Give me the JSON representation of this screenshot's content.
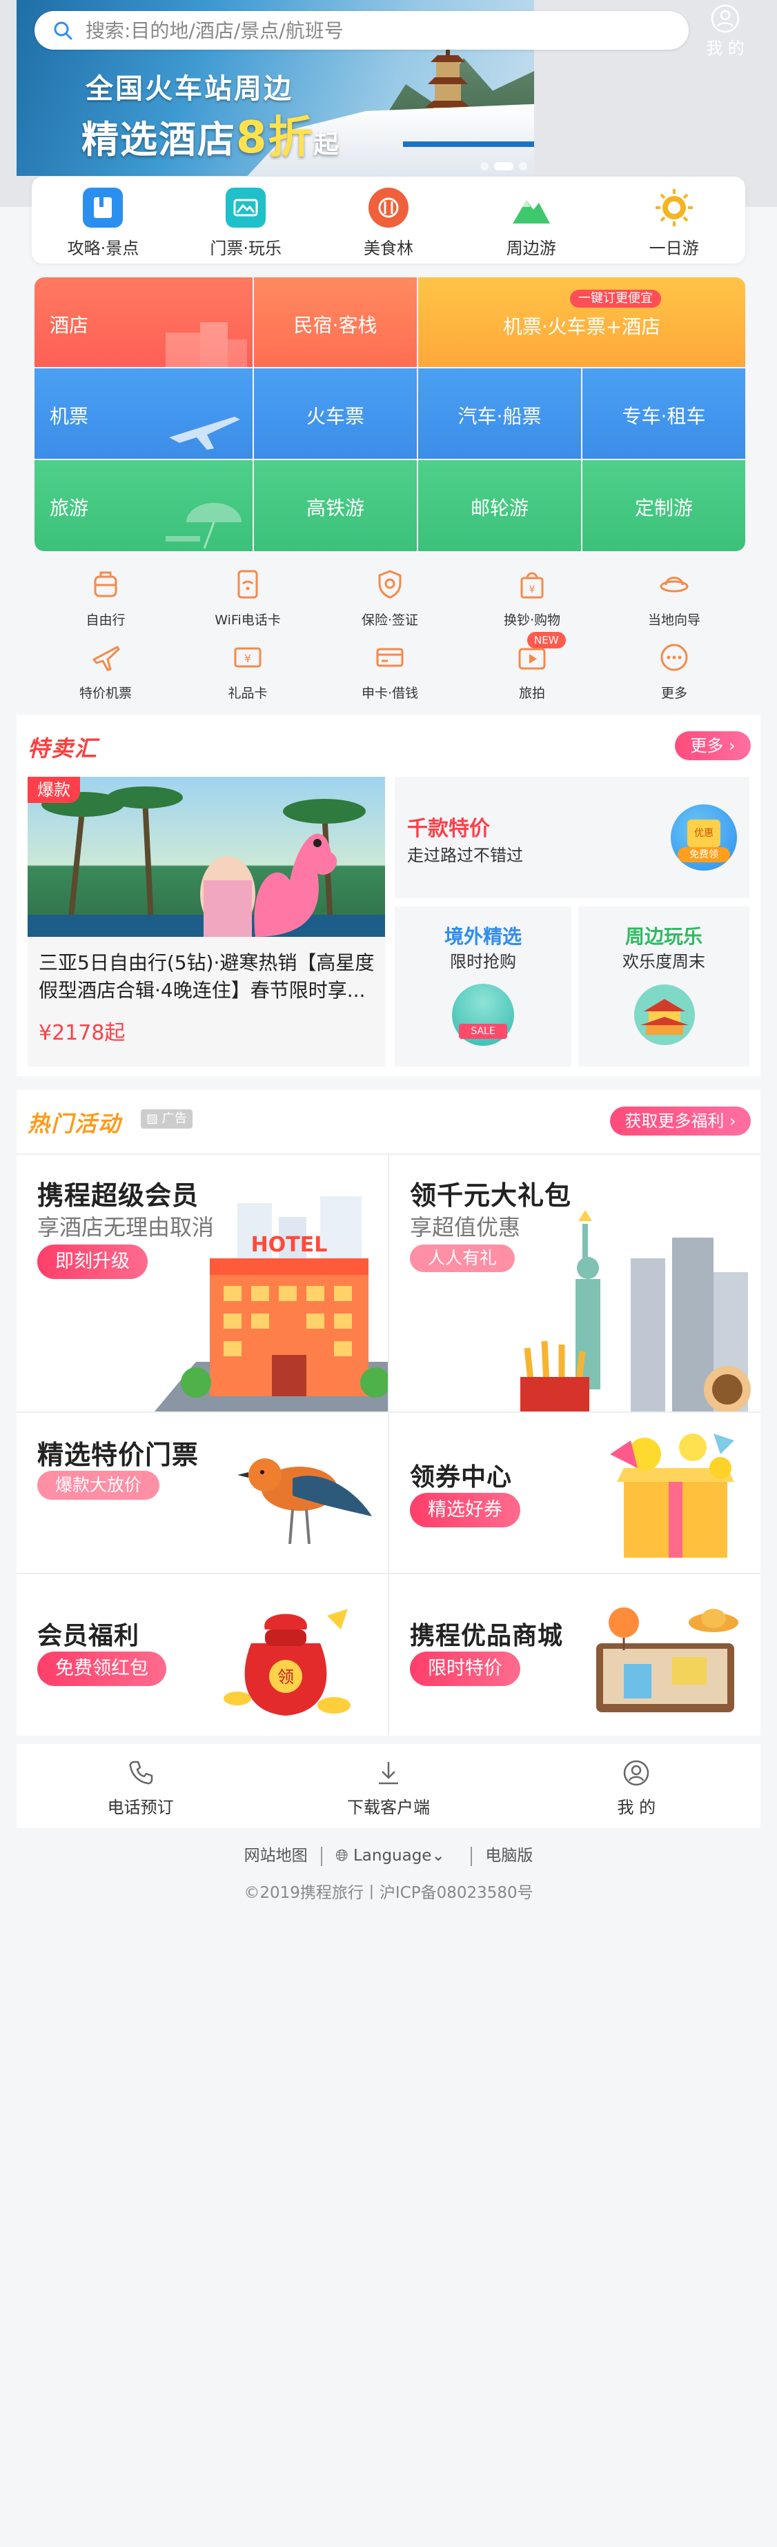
{
  "search": {
    "placeholder": "搜索:目的地/酒店/景点/航班号"
  },
  "header": {
    "mine_label": "我 的"
  },
  "banner": {
    "line1": "全国火车站周边",
    "line2_prefix": "精选酒店",
    "line2_highlight": "8折",
    "line2_suffix": "起",
    "dot_count": 3,
    "active_dot": 2
  },
  "quick_nav": [
    {
      "label": "攻略·景点",
      "icon": "guide-book-icon",
      "color": "#2b8ff0"
    },
    {
      "label": "门票·玩乐",
      "icon": "ticket-icon",
      "color": "#1fc0c9"
    },
    {
      "label": "美食林",
      "icon": "food-icon",
      "color": "#f0603a"
    },
    {
      "label": "周边游",
      "icon": "mountain-icon",
      "color": "#3ec86d"
    },
    {
      "label": "一日游",
      "icon": "sun-icon",
      "color": "#f6b420"
    }
  ],
  "grid": {
    "hotel": "酒店",
    "homestay": "民宿·客栈",
    "promo_badge": "一键订更便宜",
    "flight_train_hotel": "机票·火车票+酒店",
    "flight": "机票",
    "train": "火车票",
    "bus_ship": "汽车·船票",
    "car_rental": "专车·租车",
    "travel": "旅游",
    "hsr_tour": "高铁游",
    "cruise": "邮轮游",
    "custom_tour": "定制游"
  },
  "services_row1": [
    {
      "label": "自由行",
      "icon": "suitcase-icon"
    },
    {
      "label": "WiFi电话卡",
      "icon": "wifi-card-icon"
    },
    {
      "label": "保险·签证",
      "icon": "shield-icon"
    },
    {
      "label": "换钞·购物",
      "icon": "shopping-bag-icon"
    },
    {
      "label": "当地向导",
      "icon": "guide-hat-icon"
    }
  ],
  "services_row2": [
    {
      "label": "特价机票",
      "icon": "airplane-icon"
    },
    {
      "label": "礼品卡",
      "icon": "gift-card-icon"
    },
    {
      "label": "申卡·借钱",
      "icon": "credit-card-icon"
    },
    {
      "label": "旅拍",
      "icon": "video-icon",
      "badge": "NEW"
    },
    {
      "label": "更多",
      "icon": "more-icon"
    }
  ],
  "deals": {
    "logo": "特卖汇",
    "more": "更多",
    "hot_tag": "爆款",
    "main_title": "三亚5日自由行(5钻)·避寒热销【高星度假型酒店合辑·4晚连住】春节限时享...",
    "main_price": "¥2178起",
    "side1_title": "千款特价",
    "side1_sub": "走过路过不错过",
    "side1_badge_top": "优惠",
    "side1_badge": "免费领",
    "side2_title": "境外精选",
    "side2_sub": "限时抢购",
    "side2_badge": "SALE",
    "side3_title": "周边玩乐",
    "side3_sub": "欢乐度周末"
  },
  "activities": {
    "logo": "热门活动",
    "ad_tag": "广告",
    "more": "获取更多福利",
    "items": [
      {
        "title": "携程超级会员",
        "sub": "享酒店无理由取消",
        "btn": "即刻升级"
      },
      {
        "title": "领千元大礼包",
        "sub": "享超值优惠",
        "btn": "人人有礼"
      },
      {
        "title": "精选特价门票",
        "btn": "爆款大放价"
      },
      {
        "title": "领券中心",
        "btn": "精选好券"
      },
      {
        "title": "会员福利",
        "btn": "免费领红包"
      },
      {
        "title": "携程优品商城",
        "btn": "限时特价"
      }
    ],
    "hotel_sign": "HOTEL",
    "bag_char": "领"
  },
  "bottom_bar": [
    {
      "label": "电话预订",
      "icon": "phone-icon"
    },
    {
      "label": "下载客户端",
      "icon": "download-icon"
    },
    {
      "label": "我 的",
      "icon": "user-icon"
    }
  ],
  "footer": {
    "sitemap": "网站地图",
    "language": "Language",
    "desktop": "电脑版",
    "copyright": "©2019携程旅行丨沪ICP备08023580号"
  },
  "colors": {
    "hotel_red": "#ff6f5a",
    "hotel_orange": "#ffb23f",
    "flight_blue": "#3f97ef",
    "travel_green": "#43c886",
    "accent_pink": "#ff4d7e"
  }
}
